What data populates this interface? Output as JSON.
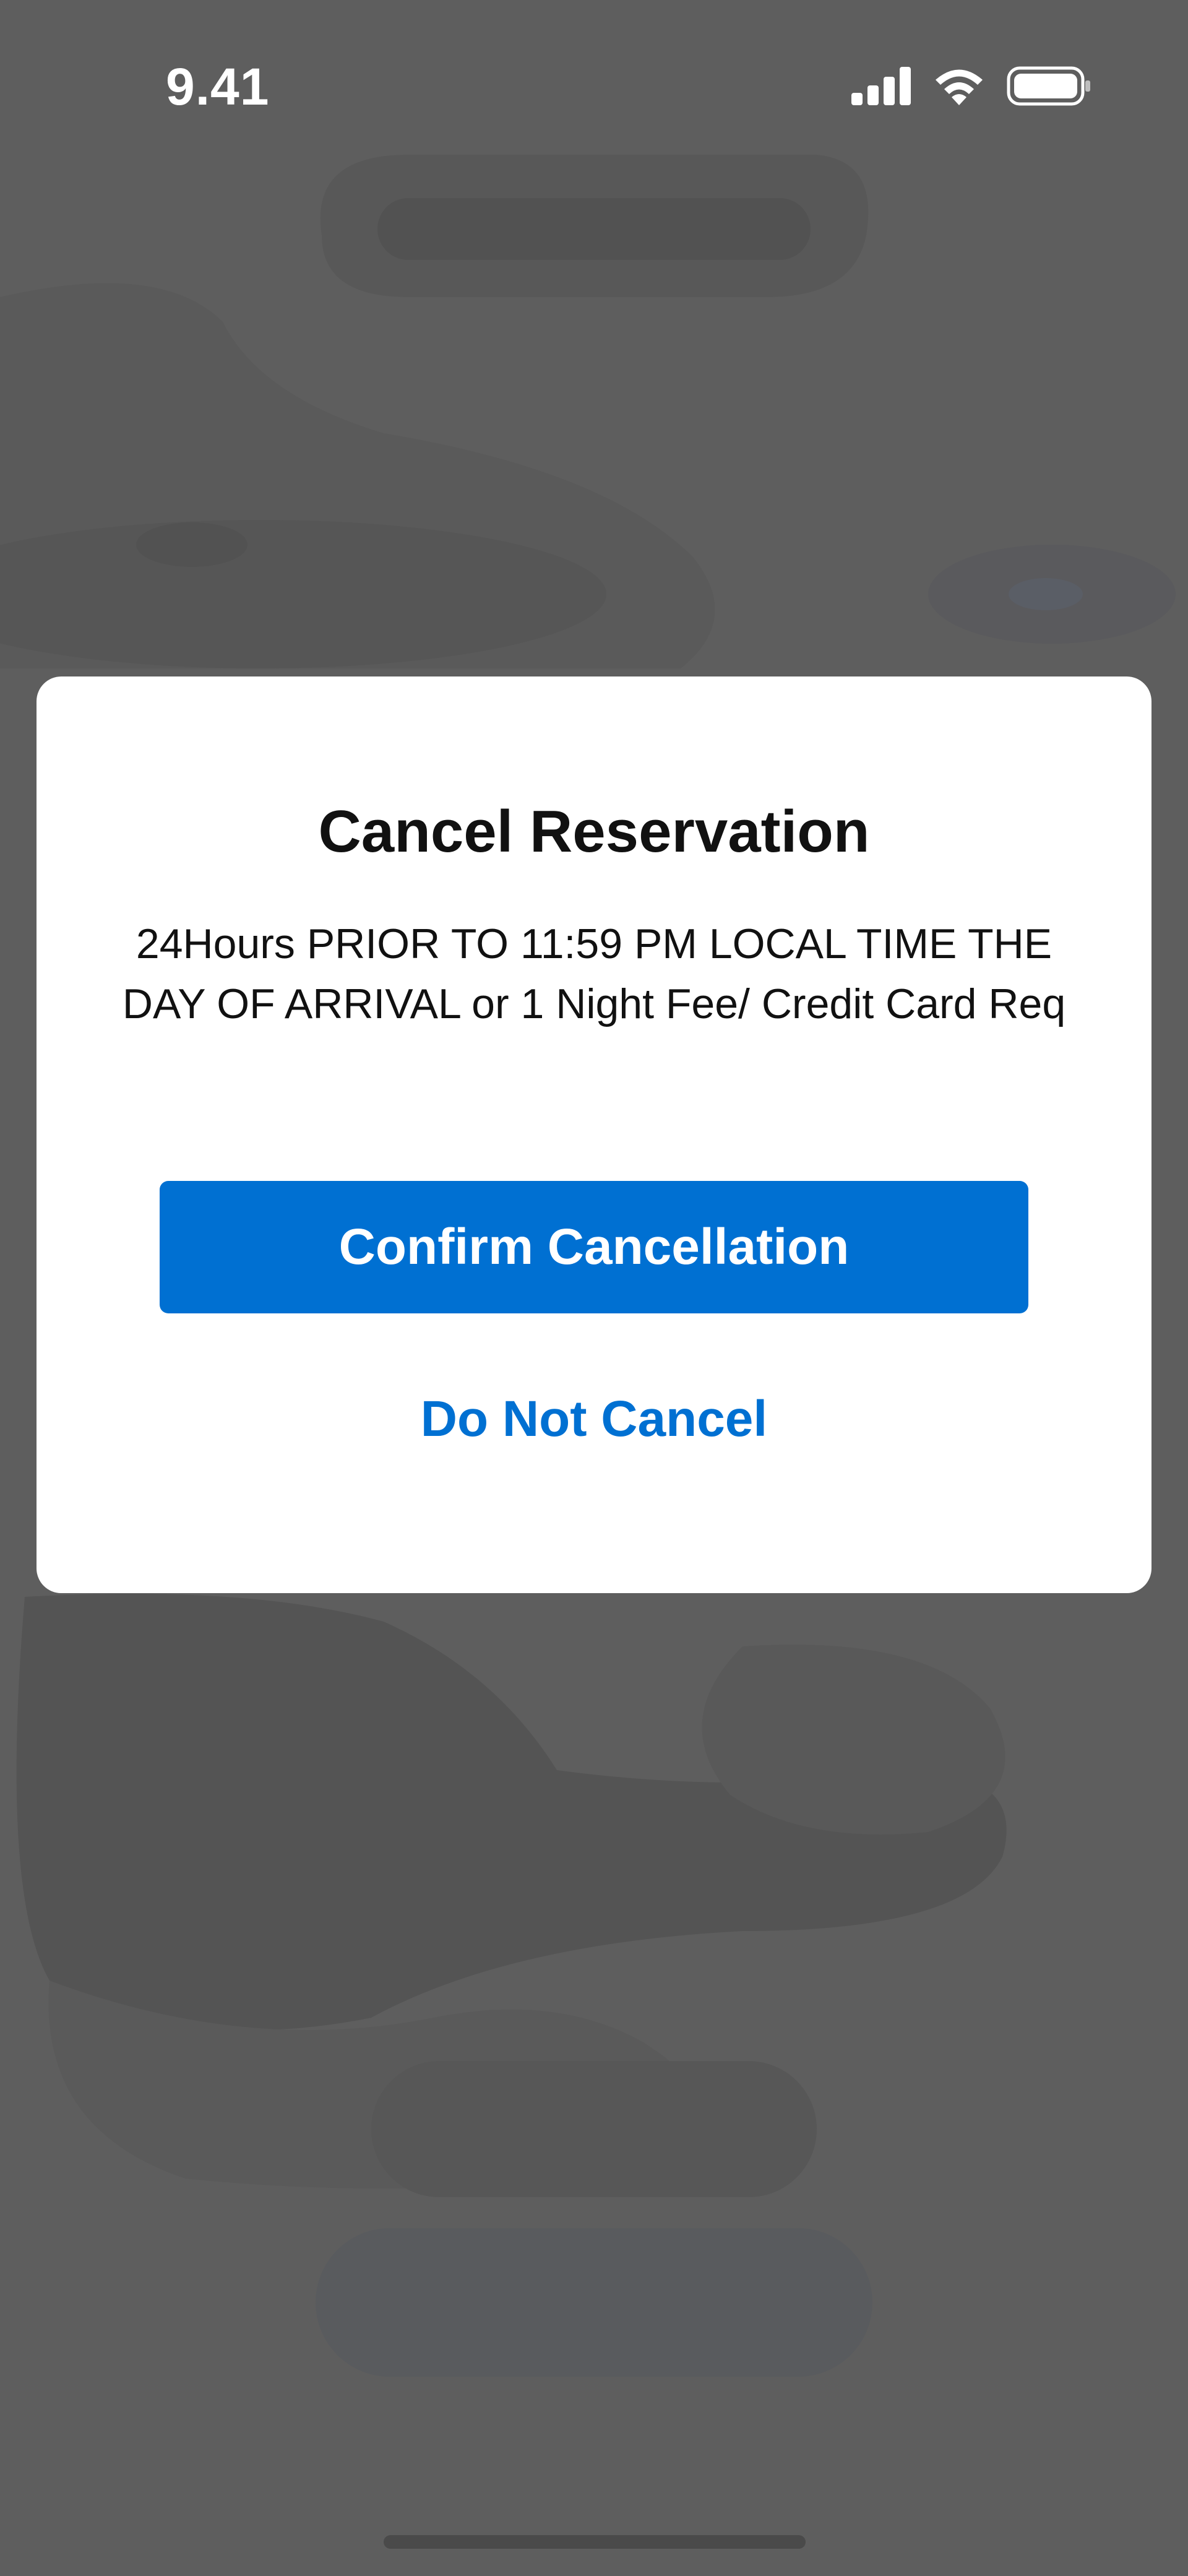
{
  "status_bar": {
    "time": "9.41",
    "icons": [
      "cellular-signal-icon",
      "wifi-icon",
      "battery-icon"
    ]
  },
  "dialog": {
    "title": "Cancel Reservation",
    "message": "24Hours PRIOR TO 11:59 PM LOCAL TIME THE DAY OF ARRIVAL or 1 Night Fee/ Credit Card Req",
    "confirm_label": "Confirm Cancellation",
    "dismiss_label": "Do Not Cancel"
  },
  "colors": {
    "accent": "#0070d2",
    "overlay": "#5e5e5e",
    "dialog_background": "#ffffff"
  }
}
